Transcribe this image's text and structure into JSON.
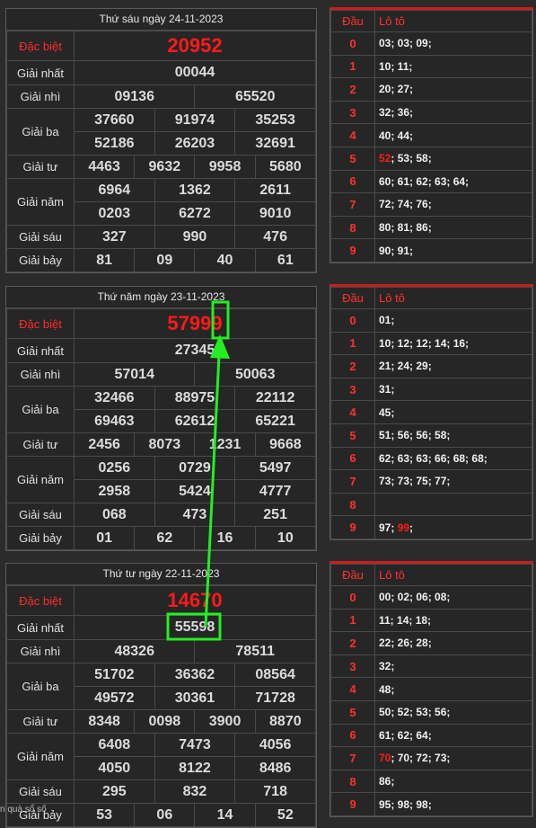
{
  "draws": [
    {
      "title": "Thứ sáu ngày 24-11-2023",
      "labels": [
        "Đặc biệt",
        "Giải nhất",
        "Giải nhì",
        "Giải ba",
        "Giải tư",
        "Giải năm",
        "Giải sáu",
        "Giải bảy"
      ],
      "db": "20952",
      "g1": "00044",
      "g2": [
        "09136",
        "65520"
      ],
      "g3": [
        "37660",
        "91974",
        "35253",
        "52186",
        "26203",
        "32691"
      ],
      "g4": [
        "4463",
        "9632",
        "9958",
        "5680"
      ],
      "g5": [
        "6964",
        "1362",
        "2611",
        "0203",
        "6272",
        "9010"
      ],
      "g6": [
        "327",
        "990",
        "476"
      ],
      "g7": [
        "81",
        "09",
        "40",
        "61"
      ],
      "loto_header": [
        "Đầu",
        "Lô tô"
      ],
      "loto": [
        {
          "d": "0",
          "v": "03; 03; 09;"
        },
        {
          "d": "1",
          "v": "10; 11;"
        },
        {
          "d": "2",
          "v": "20; 27;"
        },
        {
          "d": "3",
          "v": "32; 36;"
        },
        {
          "d": "4",
          "v": "40; 44;"
        },
        {
          "d": "5",
          "hl": "52",
          "v": "; 53; 58;"
        },
        {
          "d": "6",
          "v": "60; 61; 62; 63; 64;"
        },
        {
          "d": "7",
          "v": "72; 74; 76;"
        },
        {
          "d": "8",
          "v": "80; 81; 86;"
        },
        {
          "d": "9",
          "v": "90; 91;"
        }
      ]
    },
    {
      "title": "Thứ năm ngày 23-11-2023",
      "labels": [
        "Đặc biệt",
        "Giải nhất",
        "Giải nhì",
        "Giải ba",
        "Giải tư",
        "Giải năm",
        "Giải sáu",
        "Giải bảy"
      ],
      "db": "57999",
      "g1": "27345",
      "g2": [
        "57014",
        "50063"
      ],
      "g3": [
        "32466",
        "88975",
        "22112",
        "69463",
        "62612",
        "65221"
      ],
      "g4": [
        "2456",
        "8073",
        "1231",
        "9668"
      ],
      "g5": [
        "0256",
        "0729",
        "5497",
        "2958",
        "5424",
        "4777"
      ],
      "g6": [
        "068",
        "473",
        "251"
      ],
      "g7": [
        "01",
        "62",
        "16",
        "10"
      ],
      "loto_header": [
        "Đầu",
        "Lô tô"
      ],
      "loto": [
        {
          "d": "0",
          "v": "01;"
        },
        {
          "d": "1",
          "v": "10; 12; 12; 14; 16;"
        },
        {
          "d": "2",
          "v": "21; 24; 29;"
        },
        {
          "d": "3",
          "v": "31;"
        },
        {
          "d": "4",
          "v": "45;"
        },
        {
          "d": "5",
          "v": "51; 56; 56; 58;"
        },
        {
          "d": "6",
          "v": "62; 63; 63; 66; 68; 68;"
        },
        {
          "d": "7",
          "v": "73; 73; 75; 77;"
        },
        {
          "d": "8",
          "v": ""
        },
        {
          "d": "9",
          "v": "97; ",
          "tail": "99",
          "tailv": ";"
        }
      ]
    },
    {
      "title": "Thứ tư ngày 22-11-2023",
      "labels": [
        "Đặc biệt",
        "Giải nhất",
        "Giải nhì",
        "Giải ba",
        "Giải tư",
        "Giải năm",
        "Giải sáu",
        "Giải bảy"
      ],
      "db": "14670",
      "g1": "55598",
      "g2": [
        "48326",
        "78511"
      ],
      "g3": [
        "51702",
        "36362",
        "08564",
        "49572",
        "30361",
        "71728"
      ],
      "g4": [
        "8348",
        "0098",
        "3900",
        "8870"
      ],
      "g5": [
        "6408",
        "7473",
        "4056",
        "4050",
        "8122",
        "8486"
      ],
      "g6": [
        "295",
        "832",
        "718"
      ],
      "g7": [
        "53",
        "06",
        "14",
        "52"
      ],
      "loto_header": [
        "Đầu",
        "Lô tô"
      ],
      "loto": [
        {
          "d": "0",
          "v": "00; 02; 06; 08;"
        },
        {
          "d": "1",
          "v": "11; 14; 18;"
        },
        {
          "d": "2",
          "v": "22; 26; 28;"
        },
        {
          "d": "3",
          "v": "32;"
        },
        {
          "d": "4",
          "v": "48;"
        },
        {
          "d": "5",
          "v": "50; 52; 53; 56;"
        },
        {
          "d": "6",
          "v": "61; 62; 64;"
        },
        {
          "d": "7",
          "hl": "70",
          "v": "; 70; 72; 73;"
        },
        {
          "d": "8",
          "v": "86;"
        },
        {
          "d": "9",
          "v": "95; 98; 98;"
        }
      ]
    }
  ],
  "watermark": "n quà sổ số",
  "annotation_color": "#22ee22"
}
